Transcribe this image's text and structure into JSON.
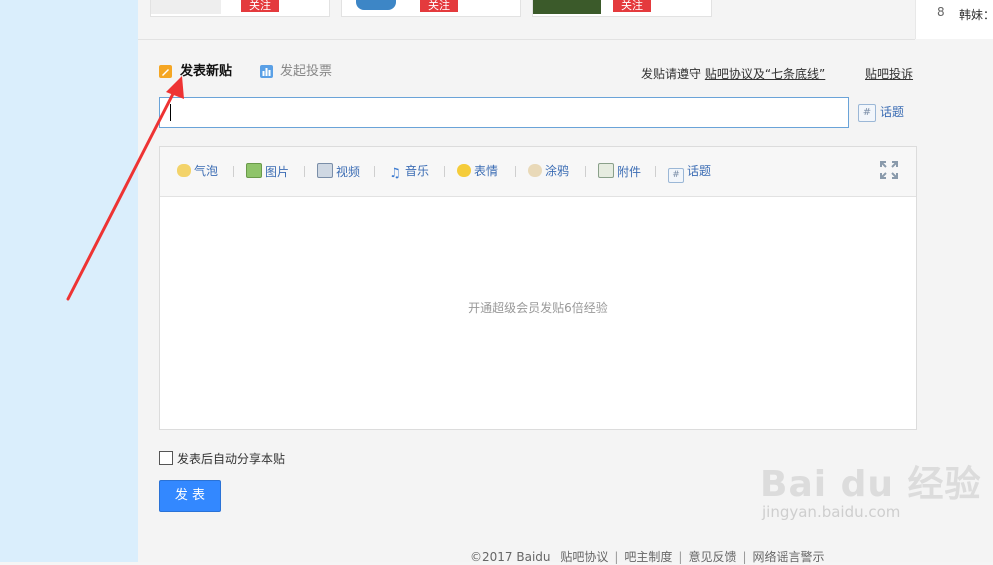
{
  "top": {
    "cards": [
      {
        "follow": "关注"
      },
      {
        "follow": "关注"
      },
      {
        "follow": "关注"
      }
    ],
    "rank": {
      "num": "8",
      "name": "韩妹："
    }
  },
  "post": {
    "tab_new": "发表新贴",
    "tab_vote": "发起投票",
    "rules_prefix": "发贴请遵守",
    "rules_link": "贴吧协议及“七条底线”",
    "complain": "贴吧投诉",
    "title_value": "",
    "topic_label": "话题",
    "topic_hash": "#"
  },
  "editor": {
    "tools": [
      {
        "label": "气泡",
        "icon": "bubble-icon"
      },
      {
        "label": "图片",
        "icon": "image-icon"
      },
      {
        "label": "视频",
        "icon": "video-icon"
      },
      {
        "label": "音乐",
        "icon": "music-icon"
      },
      {
        "label": "表情",
        "icon": "emoji-icon"
      },
      {
        "label": "涂鸦",
        "icon": "doodle-icon"
      },
      {
        "label": "附件",
        "icon": "attachment-icon"
      },
      {
        "label": "话题",
        "icon": "hash-icon"
      }
    ],
    "placeholder": "开通超级会员发贴6倍经验"
  },
  "share_label": "发表后自动分享本贴",
  "submit_label": "发 表",
  "footer": {
    "copyright": "©2017 Baidu",
    "links": [
      "贴吧协议",
      "吧主制度",
      "意见反馈",
      "网络谣言警示"
    ]
  },
  "watermark": {
    "brand": "Bai du 经验",
    "url": "jingyan.baidu.com"
  },
  "colors": {
    "accent": "#3388ff",
    "follow_red": "#e43a3d",
    "arrow_red": "#ee3333",
    "left_bg": "#daeefc"
  }
}
